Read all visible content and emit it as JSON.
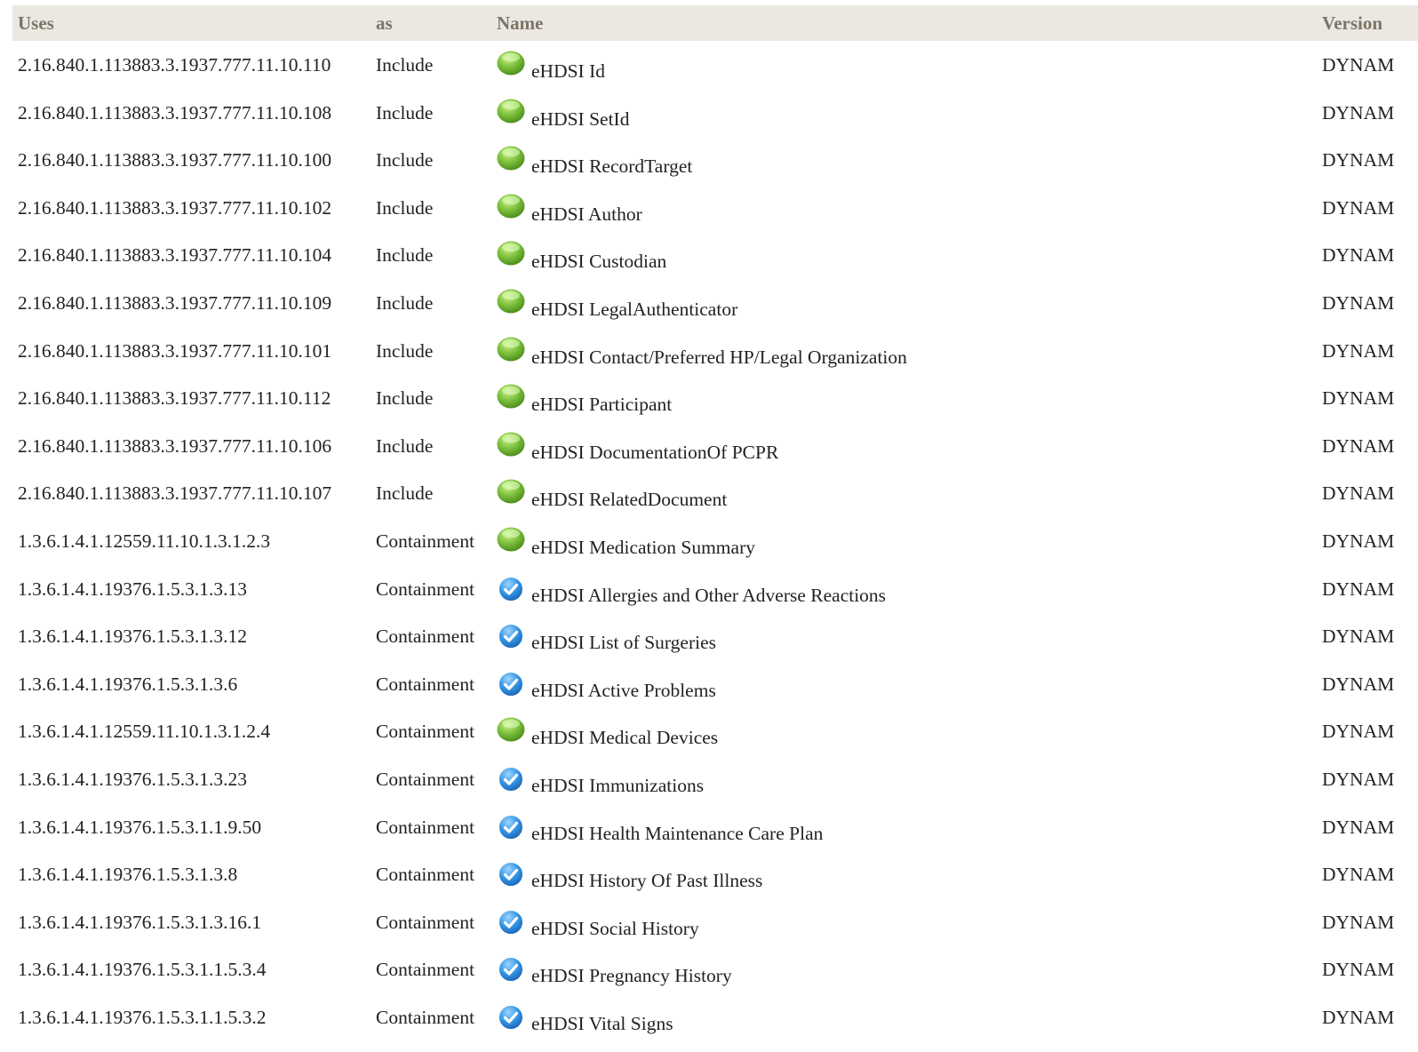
{
  "columns": {
    "uses": "Uses",
    "as": "as",
    "name": "Name",
    "version": "Version"
  },
  "rows": [
    {
      "uses": "2.16.840.1.113883.3.1937.777.11.10.110",
      "as": "Include",
      "name": "eHDSI Id",
      "icon": "green-dot-icon",
      "version": "DYNAM"
    },
    {
      "uses": "2.16.840.1.113883.3.1937.777.11.10.108",
      "as": "Include",
      "name": "eHDSI SetId",
      "icon": "green-dot-icon",
      "version": "DYNAM"
    },
    {
      "uses": "2.16.840.1.113883.3.1937.777.11.10.100",
      "as": "Include",
      "name": "eHDSI RecordTarget",
      "icon": "green-dot-icon",
      "version": "DYNAM"
    },
    {
      "uses": "2.16.840.1.113883.3.1937.777.11.10.102",
      "as": "Include",
      "name": "eHDSI Author",
      "icon": "green-dot-icon",
      "version": "DYNAM"
    },
    {
      "uses": "2.16.840.1.113883.3.1937.777.11.10.104",
      "as": "Include",
      "name": "eHDSI Custodian",
      "icon": "green-dot-icon",
      "version": "DYNAM"
    },
    {
      "uses": "2.16.840.1.113883.3.1937.777.11.10.109",
      "as": "Include",
      "name": "eHDSI LegalAuthenticator",
      "icon": "green-dot-icon",
      "version": "DYNAM"
    },
    {
      "uses": "2.16.840.1.113883.3.1937.777.11.10.101",
      "as": "Include",
      "name": "eHDSI Contact/Preferred HP/Legal Organization",
      "icon": "green-dot-icon",
      "version": "DYNAM"
    },
    {
      "uses": "2.16.840.1.113883.3.1937.777.11.10.112",
      "as": "Include",
      "name": "eHDSI Participant",
      "icon": "green-dot-icon",
      "version": "DYNAM"
    },
    {
      "uses": "2.16.840.1.113883.3.1937.777.11.10.106",
      "as": "Include",
      "name": "eHDSI DocumentationOf PCPR",
      "icon": "green-dot-icon",
      "version": "DYNAM"
    },
    {
      "uses": "2.16.840.1.113883.3.1937.777.11.10.107",
      "as": "Include",
      "name": "eHDSI RelatedDocument",
      "icon": "green-dot-icon",
      "version": "DYNAM"
    },
    {
      "uses": "1.3.6.1.4.1.12559.11.10.1.3.1.2.3",
      "as": "Containment",
      "name": "eHDSI Medication Summary",
      "icon": "green-dot-icon",
      "version": "DYNAM"
    },
    {
      "uses": "1.3.6.1.4.1.19376.1.5.3.1.3.13",
      "as": "Containment",
      "name": "eHDSI Allergies and Other Adverse Reactions",
      "icon": "blue-check-icon",
      "version": "DYNAM"
    },
    {
      "uses": "1.3.6.1.4.1.19376.1.5.3.1.3.12",
      "as": "Containment",
      "name": "eHDSI List of Surgeries",
      "icon": "blue-check-icon",
      "version": "DYNAM"
    },
    {
      "uses": "1.3.6.1.4.1.19376.1.5.3.1.3.6",
      "as": "Containment",
      "name": "eHDSI Active Problems",
      "icon": "blue-check-icon",
      "version": "DYNAM"
    },
    {
      "uses": "1.3.6.1.4.1.12559.11.10.1.3.1.2.4",
      "as": "Containment",
      "name": "eHDSI Medical Devices",
      "icon": "green-dot-icon",
      "version": "DYNAM"
    },
    {
      "uses": "1.3.6.1.4.1.19376.1.5.3.1.3.23",
      "as": "Containment",
      "name": "eHDSI Immunizations",
      "icon": "blue-check-icon",
      "version": "DYNAM"
    },
    {
      "uses": "1.3.6.1.4.1.19376.1.5.3.1.1.9.50",
      "as": "Containment",
      "name": "eHDSI Health Maintenance Care Plan",
      "icon": "blue-check-icon",
      "version": "DYNAM"
    },
    {
      "uses": "1.3.6.1.4.1.19376.1.5.3.1.3.8",
      "as": "Containment",
      "name": "eHDSI History Of Past Illness",
      "icon": "blue-check-icon",
      "version": "DYNAM"
    },
    {
      "uses": "1.3.6.1.4.1.19376.1.5.3.1.3.16.1",
      "as": "Containment",
      "name": "eHDSI Social History",
      "icon": "blue-check-icon",
      "version": "DYNAM"
    },
    {
      "uses": "1.3.6.1.4.1.19376.1.5.3.1.1.5.3.4",
      "as": "Containment",
      "name": "eHDSI Pregnancy History",
      "icon": "blue-check-icon",
      "version": "DYNAM"
    },
    {
      "uses": "1.3.6.1.4.1.19376.1.5.3.1.1.5.3.2",
      "as": "Containment",
      "name": "eHDSI Vital Signs",
      "icon": "blue-check-icon",
      "version": "DYNAM"
    }
  ],
  "colors": {
    "header_bg": "#ebe8e2",
    "header_text": "#7d7466",
    "green": "#7cc03c",
    "blue": "#2e8fe0"
  }
}
